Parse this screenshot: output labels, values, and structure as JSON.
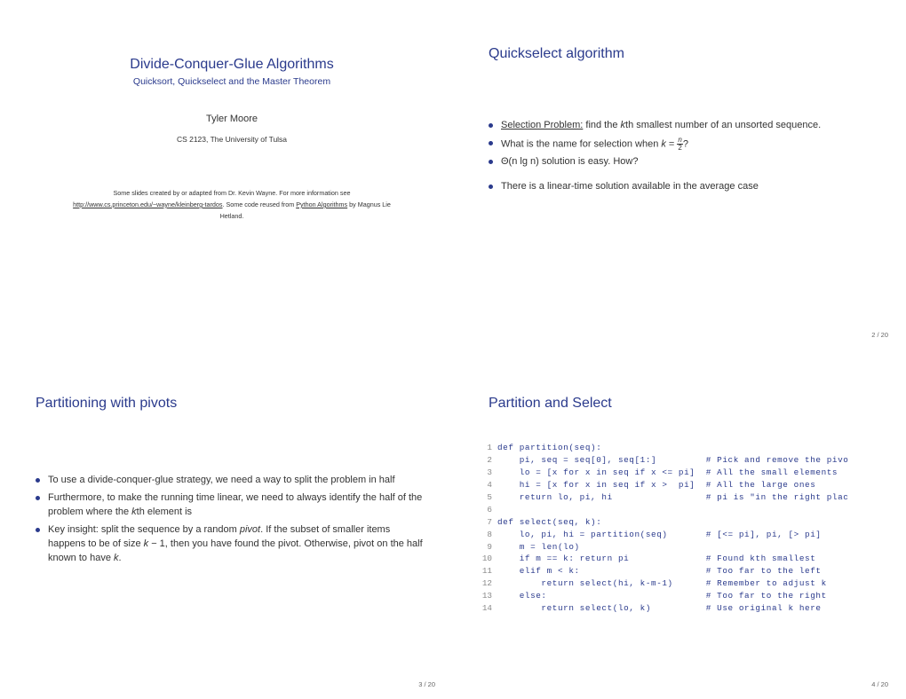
{
  "slide1": {
    "title": "Divide-Conquer-Glue Algorithms",
    "subtitle": "Quicksort, Quickselect and the Master Theorem",
    "author": "Tyler Moore",
    "affil": "CS 2123, The University of Tulsa",
    "credits_l1": "Some slides created by or adapted from Dr. Kevin Wayne. For more information see",
    "credits_url": "http://www.cs.princeton.edu/~wayne/kleinberg-tardos",
    "credits_l2a": ". Some code reused from ",
    "credits_book": "Python Algorithms",
    "credits_l2b": " by Magnus Lie",
    "credits_l3": "Hetland."
  },
  "slide2": {
    "title": "Quickselect algorithm",
    "b1a": "Selection Problem:",
    "b1b": " find the ",
    "b1c": "k",
    "b1d": "th smallest number of an unsorted sequence.",
    "b2a": "What is the name for selection when ",
    "b2b": "k",
    "b2c": " = ",
    "b2n": "n",
    "b2dn": "2",
    "b2e": "?",
    "b3": "Θ(n lg n) solution is easy. How?",
    "b4": "There is a linear-time solution available in the average case",
    "page": "2 / 20"
  },
  "slide3": {
    "title": "Partitioning with pivots",
    "b1": "To use a divide-conquer-glue strategy, we need a way to split the problem in half",
    "b2a": "Furthermore, to make the running time linear, we need to always identify the half of the problem where the ",
    "b2k": "k",
    "b2b": "th element is",
    "b3a": "Key insight: split the sequence by a random ",
    "b3p": "pivot",
    "b3b": ". If the subset of smaller items happens to be of size ",
    "b3k": "k",
    "b3c": " − 1, then you have found the pivot. Otherwise, pivot on the half known to have ",
    "b3k2": "k",
    "b3d": ".",
    "page": "3 / 20"
  },
  "slide4": {
    "title": "Partition and Select",
    "page": "4 / 20",
    "code": {
      "l1": "def partition(seq):",
      "l2": "    pi, seq = seq[0], seq[1:]         # Pick and remove the pivo",
      "l3": "    lo = [x for x in seq if x <= pi]  # All the small elements",
      "l4": "    hi = [x for x in seq if x >  pi]  # All the large ones",
      "l5": "    return lo, pi, hi                 # pi is \"in the right plac",
      "l6": "",
      "l7": "def select(seq, k):",
      "l8": "    lo, pi, hi = partition(seq)       # [<= pi], pi, [> pi]",
      "l9": "    m = len(lo)",
      "l10": "    if m == k: return pi              # Found kth smallest",
      "l11": "    elif m < k:                       # Too far to the left",
      "l12": "        return select(hi, k-m-1)      # Remember to adjust k",
      "l13": "    else:                             # Too far to the right",
      "l14": "        return select(lo, k)          # Use original k here"
    }
  }
}
